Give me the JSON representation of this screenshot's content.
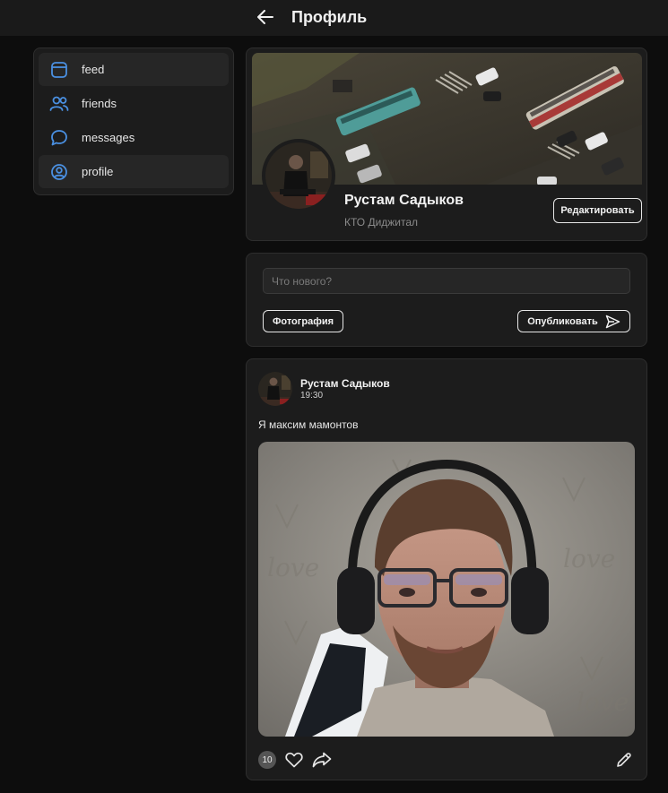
{
  "header": {
    "title": "Профиль",
    "back_icon": "arrow-left-icon"
  },
  "sidebar": {
    "accent_color": "#4a90e2",
    "items": [
      {
        "label": "feed",
        "icon": "window-icon",
        "active": true
      },
      {
        "label": "friends",
        "icon": "users-icon",
        "active": false
      },
      {
        "label": "messages",
        "icon": "chat-bubble-icon",
        "active": false
      },
      {
        "label": "profile",
        "icon": "user-circle-icon",
        "active": true
      }
    ]
  },
  "profile": {
    "name": "Рустам Садыков",
    "subtitle": "КТО Диджитал",
    "edit_label": "Редактировать"
  },
  "compose": {
    "placeholder": "Что нового?",
    "photo_label": "Фотография",
    "publish_label": "Опубликовать",
    "publish_icon": "send-icon"
  },
  "post": {
    "author": "Рустам Садыков",
    "time": "19:30",
    "text": "Я максим мамонтов",
    "likes": "10",
    "like_icon": "heart-icon",
    "share_icon": "share-icon",
    "edit_icon": "pencil-icon"
  }
}
